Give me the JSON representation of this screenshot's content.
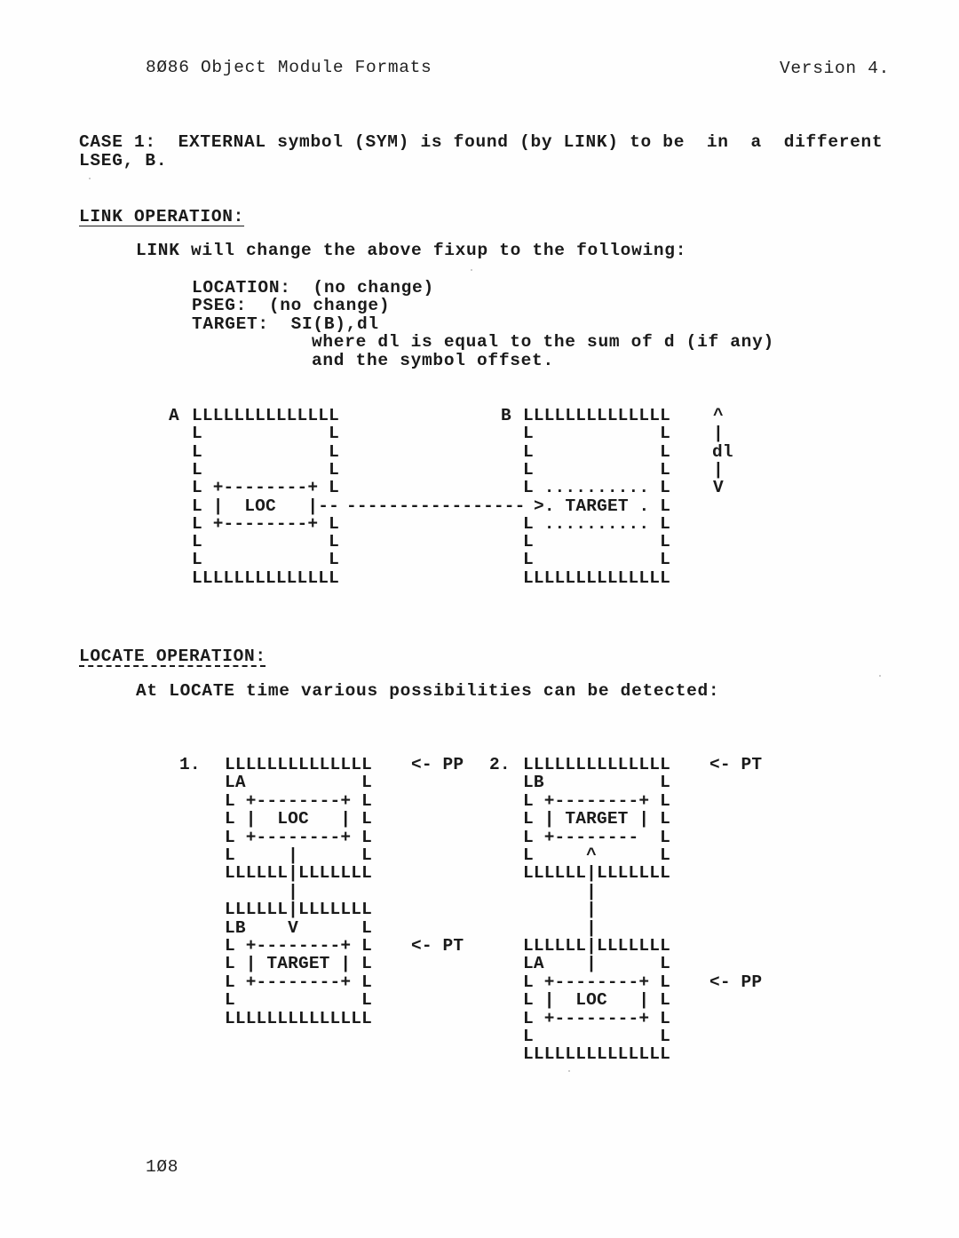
{
  "header": {
    "title": "8Ø86 Object Module Formats",
    "version": "Version 4."
  },
  "case1": {
    "line1": "CASE 1:  EXTERNAL symbol (SYM) is found (by LINK) to be  in  a  different",
    "line2": "LSEG, B."
  },
  "link_operation": {
    "heading": "LINK OPERATION:",
    "intro": "LINK will change the above fixup to the following:",
    "fields": [
      "LOCATION:  (no change)",
      "PSEG:  (no change)",
      "TARGET:  SI(B),dl"
    ],
    "note": [
      "where dl is equal to the sum of d (if any)",
      "and the symbol offset."
    ],
    "diagram": {
      "left_label": "A",
      "right_label": "B",
      "rows": [
        {
          "left": "LLLLLLLLLLLLLL",
          "mid": "",
          "right": "LLLLLLLLLLLLLL",
          "side": "^"
        },
        {
          "left": "L            L",
          "mid": "",
          "right": "L            L",
          "side": "|"
        },
        {
          "left": "L            L",
          "mid": "",
          "right": "L            L",
          "side": "dl"
        },
        {
          "left": "L            L",
          "mid": "",
          "right": "L            L",
          "side": "|"
        },
        {
          "left": "L +--------+ L",
          "mid": "",
          "right": "L .......... L",
          "side": "V"
        },
        {
          "left": "L |  LOC   |--",
          "mid": "-----------------",
          "right": ">. TARGET . L",
          "side": ""
        },
        {
          "left": "L +--------+ L",
          "mid": "",
          "right": "L .......... L",
          "side": ""
        },
        {
          "left": "L            L",
          "mid": "",
          "right": "L            L",
          "side": ""
        },
        {
          "left": "L            L",
          "mid": "",
          "right": "L            L",
          "side": ""
        },
        {
          "left": "LLLLLLLLLLLLLL",
          "mid": "",
          "right": "LLLLLLLLLLLLLL",
          "side": ""
        }
      ]
    }
  },
  "locate_operation": {
    "heading": "LOCATE OPERATION:",
    "intro": "At LOCATE time various possibilities can be detected:",
    "case1": {
      "number": "1.",
      "rows": [
        "LLLLLLLLLLLLLL",
        "LA           L",
        "L +--------+ L",
        "L |  LOC   | L",
        "L +--------+ L",
        "L     |      L",
        "LLLLLL|LLLLLLL",
        "      |",
        "LLLLLL|LLLLLLL",
        "LB    V      L",
        "L +--------+ L",
        "L | TARGET | L",
        "L +--------+ L",
        "L            L",
        "LLLLLLLLLLLLLL"
      ],
      "pointers": [
        {
          "row": 0,
          "label": "<- PP"
        },
        {
          "row": 10,
          "label": "<- PT"
        }
      ]
    },
    "case2": {
      "number": "2.",
      "rows": [
        "LLLLLLLLLLLLLL",
        "LB           L",
        "L +--------+ L",
        "L | TARGET | L",
        "L +--------  L",
        "L     ^      L",
        "LLLLLL|LLLLLLL",
        "      |",
        "      |",
        "      |",
        "LLLLLL|LLLLLLL",
        "LA    |      L",
        "L +--------+ L",
        "L |  LOC   | L",
        "L +--------+ L",
        "L            L",
        "LLLLLLLLLLLLLL"
      ],
      "pointers": [
        {
          "row": 0,
          "label": "<- PT"
        },
        {
          "row": 12,
          "label": "<- PP"
        }
      ]
    }
  },
  "footer": {
    "page_number": "1Ø8"
  }
}
